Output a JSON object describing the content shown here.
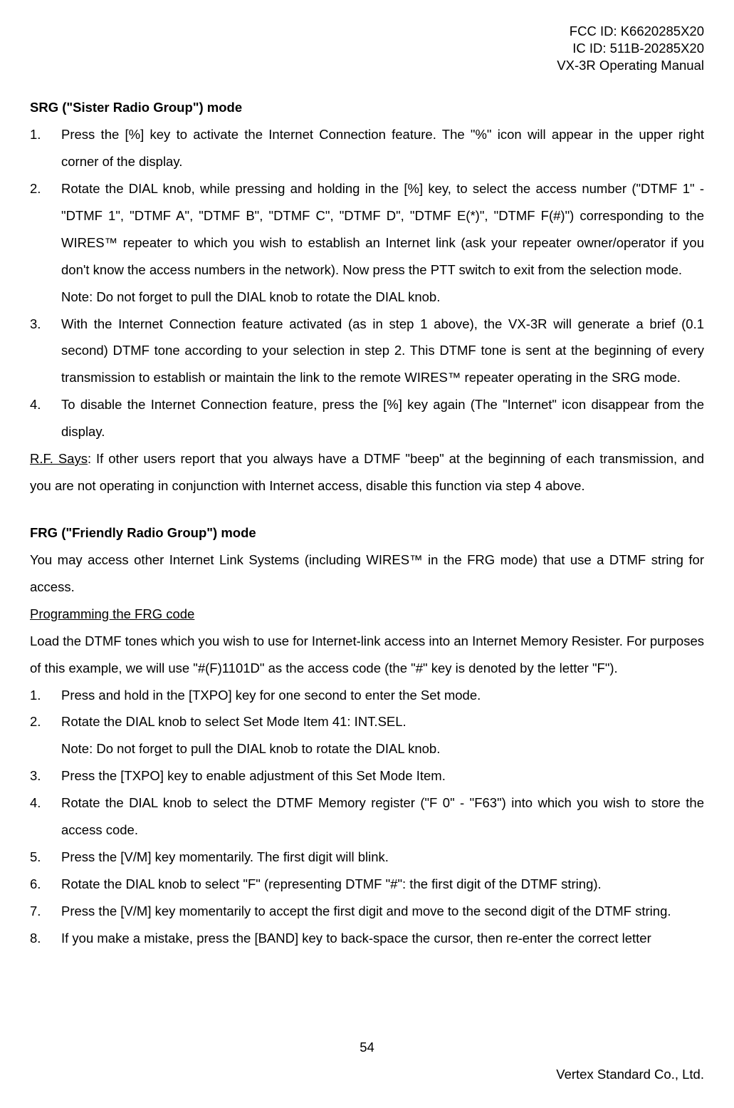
{
  "header": {
    "fcc": "FCC ID: K6620285X20",
    "ic": "IC ID: 511B-20285X20",
    "manual": "VX-3R Operating Manual"
  },
  "srg": {
    "title": "SRG (\"Sister Radio Group\") mode",
    "items": [
      {
        "num": "1.",
        "text": "Press the [%] key to activate the Internet Connection feature. The \"%\" icon will appear in the upper right corner of the display."
      },
      {
        "num": "2.",
        "text": "Rotate the DIAL knob, while pressing and holding in the [%] key, to select the access number (\"DTMF 1\" - \"DTMF 1\", \"DTMF A\", \"DTMF B\", \"DTMF C\", \"DTMF D\", \"DTMF E(*)\", \"DTMF F(#)\") corresponding to the WIRES™ repeater to which you wish to establish an Internet link (ask your repeater owner/operator if you don't know the access numbers in the network). Now press the PTT switch to exit from the selection mode.",
        "note": "Note: Do not forget to pull the DIAL knob to rotate the DIAL knob."
      },
      {
        "num": "3.",
        "text": "With the Internet Connection feature activated (as in step 1 above), the VX-3R will generate a brief (0.1 second) DTMF tone according to your selection in step 2. This DTMF tone is sent at the beginning of every transmission to establish or maintain the link to the remote WIRES™ repeater operating in the SRG mode."
      },
      {
        "num": "4.",
        "text": "To disable the Internet Connection feature, press the [%] key again (The \"Internet\" icon disappear from the display."
      }
    ],
    "rf_label": "R.F. Says",
    "rf_text": ": If other users report that you always have a DTMF \"beep\" at the beginning of each transmission, and you are not operating in conjunction with Internet access, disable this function via step 4 above."
  },
  "frg": {
    "title": "FRG (\"Friendly Radio Group\") mode",
    "intro": "You may access other Internet Link Systems (including WIRES™ in the FRG mode) that use a DTMF string for access.",
    "prog_label": "Programming the FRG code",
    "load_text": "Load the DTMF tones which you wish to use for Internet-link access into an Internet Memory Resister. For purposes of this example, we will use \"#(F)1101D\" as the access code (the \"#\" key is denoted by the letter \"F\").",
    "items": [
      {
        "num": "1.",
        "text": "Press and hold in the [TXPO] key for one second to enter the Set mode."
      },
      {
        "num": "2.",
        "text": "Rotate the DIAL knob to select Set Mode Item 41: INT.SEL.",
        "note": "Note: Do not forget to pull the DIAL knob to rotate the DIAL knob."
      },
      {
        "num": "3.",
        "text": "Press the [TXPO] key to enable adjustment of this Set Mode Item."
      },
      {
        "num": "4.",
        "text": "Rotate the DIAL knob to select the DTMF Memory register (\"F 0\" - \"F63\") into which you wish to store the access code."
      },
      {
        "num": "5.",
        "text": "Press the [V/M] key momentarily. The first digit will blink."
      },
      {
        "num": "6.",
        "text": "Rotate the DIAL knob to select \"F\" (representing DTMF \"#\": the first digit of the DTMF string)."
      },
      {
        "num": "7.",
        "text": "Press the [V/M] key momentarily to accept the first digit and move to the second digit of the DTMF string."
      },
      {
        "num": "8.",
        "text": "If you make a mistake, press the [BAND] key to back-space the cursor, then re-enter the correct letter"
      }
    ]
  },
  "footer": {
    "page": "54",
    "vendor": "Vertex Standard Co., Ltd."
  }
}
